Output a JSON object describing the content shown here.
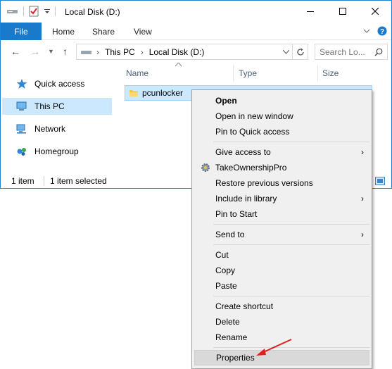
{
  "window": {
    "title": "Local Disk (D:)",
    "accent_color": "#1979ca"
  },
  "ribbon": {
    "file_tab": "File",
    "tabs": [
      "Home",
      "Share",
      "View"
    ]
  },
  "address_bar": {
    "crumbs": [
      "This PC",
      "Local Disk (D:)"
    ],
    "search_placeholder": "Search Lo..."
  },
  "sidebar": {
    "items": [
      {
        "label": "Quick access",
        "icon": "star-icon"
      },
      {
        "label": "This PC",
        "icon": "computer-icon"
      },
      {
        "label": "Network",
        "icon": "network-icon"
      },
      {
        "label": "Homegroup",
        "icon": "homegroup-icon"
      }
    ]
  },
  "file_list": {
    "columns": [
      "Name",
      "Type",
      "Size"
    ],
    "rows": [
      {
        "name": "pcunlocker",
        "icon": "folder-icon"
      }
    ]
  },
  "status_bar": {
    "item_count": "1 item",
    "selected": "1 item selected"
  },
  "context_menu": {
    "items": {
      "open": "Open",
      "open_new_window": "Open in new window",
      "pin_quick_access": "Pin to Quick access",
      "give_access": "Give access to",
      "take_ownership": "TakeOwnershipPro",
      "restore_versions": "Restore previous versions",
      "include_library": "Include in library",
      "pin_start": "Pin to Start",
      "send_to": "Send to",
      "cut": "Cut",
      "copy": "Copy",
      "paste": "Paste",
      "create_shortcut": "Create shortcut",
      "delete": "Delete",
      "rename": "Rename",
      "properties": "Properties"
    }
  }
}
